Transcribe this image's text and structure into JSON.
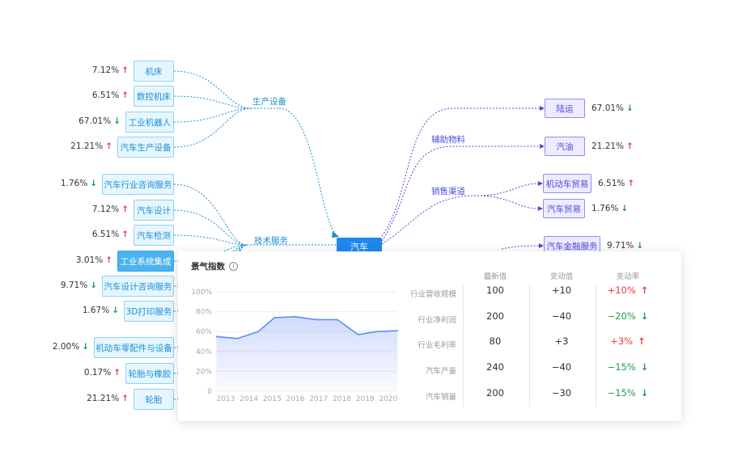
{
  "colors": {
    "cyan": "#1a8fd6",
    "purple": "#4b4bd8",
    "center": "#1e88f0",
    "up": "#f03c3c",
    "down": "#1f9c4a"
  },
  "center_node": "汽车",
  "groups": {
    "left": [
      "生产设备",
      "技术服务"
    ],
    "right": [
      "辅助物料",
      "销售渠道"
    ]
  },
  "left_nodes": [
    {
      "label": "机床",
      "pct": "7.12%",
      "dir": "up"
    },
    {
      "label": "数控机床",
      "pct": "6.51%",
      "dir": "up"
    },
    {
      "label": "工业机器人",
      "pct": "67.01%",
      "dir": "down"
    },
    {
      "label": "汽车生产设备",
      "pct": "21.21%",
      "dir": "up"
    },
    {
      "label": "汽车行业咨询服务",
      "pct": "1.76%",
      "dir": "down"
    },
    {
      "label": "汽车设计",
      "pct": "7.12%",
      "dir": "up"
    },
    {
      "label": "汽车检测",
      "pct": "6.51%",
      "dir": "up"
    },
    {
      "label": "工业系统集成",
      "pct": "3.01%",
      "dir": "up"
    },
    {
      "label": "汽车设计咨询服务",
      "pct": "9.71%",
      "dir": "down"
    },
    {
      "label": "3D打印服务",
      "pct": "1.67%",
      "dir": "down"
    },
    {
      "label": "机动车零配件与设备",
      "pct": "2.00%",
      "dir": "down"
    },
    {
      "label": "轮胎与橡胶",
      "pct": "0.17%",
      "dir": "up"
    },
    {
      "label": "轮胎",
      "pct": "21.21%",
      "dir": "up"
    }
  ],
  "right_nodes": [
    {
      "label": "陆运",
      "pct": "67.01%",
      "dir": "down"
    },
    {
      "label": "汽油",
      "pct": "21.21%",
      "dir": "up"
    },
    {
      "label": "机动车贸易",
      "pct": "6.51%",
      "dir": "up"
    },
    {
      "label": "汽车贸易",
      "pct": "1.76%",
      "dir": "down"
    },
    {
      "label": "汽车金融服务",
      "pct": "9.71%",
      "dir": "down"
    }
  ],
  "panel": {
    "title": "景气指数",
    "info_icon": "info-icon",
    "columns": [
      "最新值",
      "变动值",
      "变动率"
    ],
    "rows": [
      {
        "label": "行业营收规模",
        "latest": "100",
        "change": "+10",
        "rate": "+10%",
        "dir": "up"
      },
      {
        "label": "行业净利润",
        "latest": "200",
        "change": "−40",
        "rate": "−20%",
        "dir": "down"
      },
      {
        "label": "行业毛利率",
        "latest": "80",
        "change": "+3",
        "rate": "+3%",
        "dir": "up"
      },
      {
        "label": "汽车产量",
        "latest": "240",
        "change": "−40",
        "rate": "−15%",
        "dir": "down"
      },
      {
        "label": "汽车销量",
        "latest": "200",
        "change": "−30",
        "rate": "−15%",
        "dir": "down"
      }
    ]
  },
  "chart_data": {
    "type": "area",
    "x": [
      "2013",
      "2014",
      "2015",
      "2016",
      "2017",
      "2018",
      "2019",
      "2020"
    ],
    "series": [
      {
        "values": [
          55,
          53,
          60,
          74,
          75,
          72,
          72,
          57,
          60,
          61
        ]
      }
    ],
    "x_values": [
      2012.6,
      2013.5,
      2014.4,
      2015.1,
      2016.0,
      2016.9,
      2017.8,
      2018.7,
      2019.5,
      2020.4
    ],
    "yticks": [
      "0",
      "20%",
      "40%",
      "60%",
      "80%",
      "100%"
    ],
    "ylim": [
      0,
      100
    ],
    "grid": true
  }
}
